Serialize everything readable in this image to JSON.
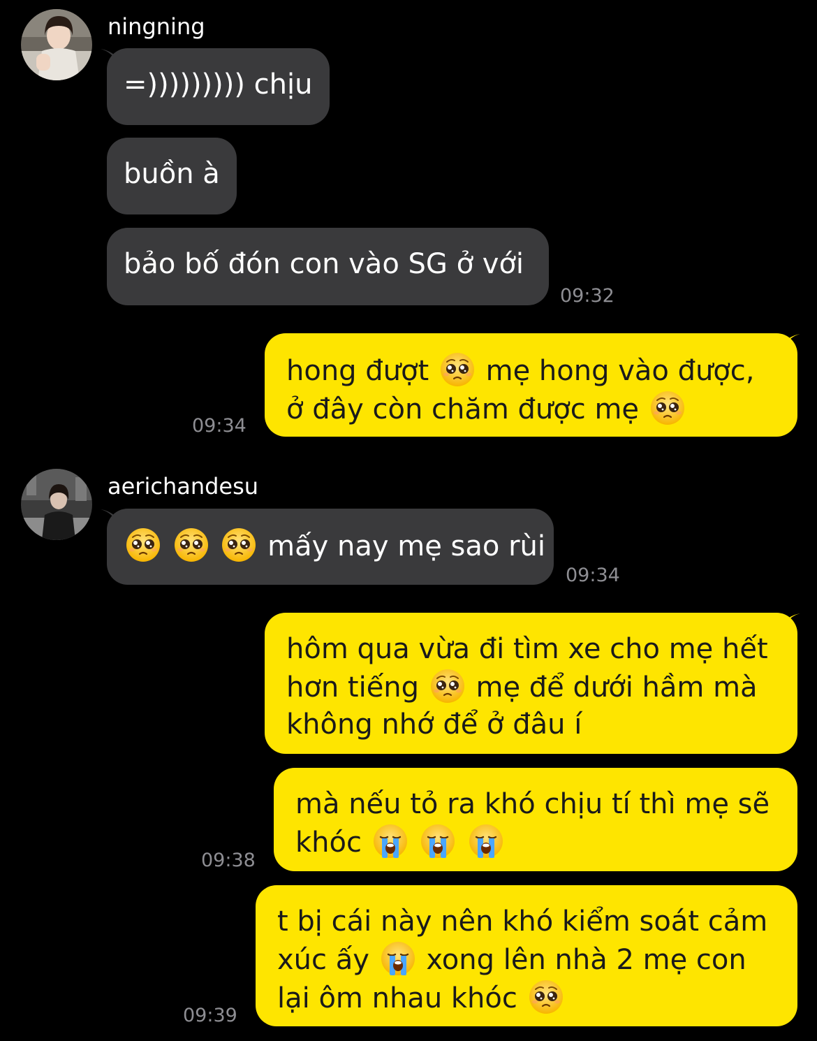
{
  "colors": {
    "background": "#000000",
    "incoming_bubble": "#3a3a3c",
    "outgoing_bubble": "#fee500",
    "timestamp": "#8e8e93"
  },
  "groups": [
    {
      "sender": "ningning",
      "messages": [
        "=))))))))) chịu",
        "buồn à",
        "bảo bố đón con vào SG ở với"
      ],
      "time": "09:32"
    },
    {
      "outgoing": [
        {
          "lines": [
            "hong đượt [pleading-face] mẹ hong vào được,",
            "ở đây còn chăm được mẹ [pleading-face]"
          ],
          "time": "09:34"
        }
      ]
    },
    {
      "sender": "aerichandesu",
      "messages": [
        "[pleading-face] [pleading-face] [pleading-face] mấy nay mẹ sao rùi"
      ],
      "time": "09:34"
    },
    {
      "outgoing": [
        {
          "lines": [
            "hôm qua vừa đi tìm xe cho mẹ hết",
            "hơn tiếng [pleading-face] mẹ để dưới hầm mà",
            "không nhớ để ở đâu í"
          ]
        },
        {
          "lines": [
            "mà nếu tỏ ra khó chịu tí thì mẹ sẽ",
            "khóc [loudly-crying-face] [loudly-crying-face] [loudly-crying-face]"
          ],
          "time": "09:38"
        },
        {
          "lines": [
            "t bị cái này nên khó kiểm soát cảm",
            "xúc ấy [loudly-crying-face] xong lên nhà 2 mẹ con",
            "lại ôm nhau khóc [pleading-face]"
          ],
          "time": "09:39"
        }
      ]
    }
  ],
  "text": {
    "n_msg1": "=))))))))) chịu",
    "n_msg2": "buồn à",
    "n_msg3": "bảo bố đón con vào SG ở với",
    "n_time": "09:32",
    "o1_l1a": "hong đượt ",
    "o1_l1b": " mẹ hong vào được,",
    "o1_l2a": "ở đây còn chăm được mẹ ",
    "o1_time": "09:34",
    "a_sender": "aerichandesu",
    "n_sender": "ningning",
    "a_msg1": " mấy nay mẹ sao rùi",
    "a_time": "09:34",
    "o2_l1": "hôm qua vừa đi tìm xe cho mẹ hết",
    "o2_l2a": "hơn tiếng ",
    "o2_l2b": " mẹ để dưới hầm mà",
    "o2_l3": "không nhớ để ở đâu í",
    "o3_l1": "mà nếu tỏ ra khó chịu tí thì mẹ sẽ",
    "o3_l2a": "khóc ",
    "o3_time": "09:38",
    "o4_l1": "t bị cái này nên khó kiểm soát cảm",
    "o4_l2a": "xúc ấy ",
    "o4_l2b": " xong lên nhà 2 mẹ con",
    "o4_l3a": "lại ôm nhau khóc ",
    "o4_time": "09:39"
  }
}
